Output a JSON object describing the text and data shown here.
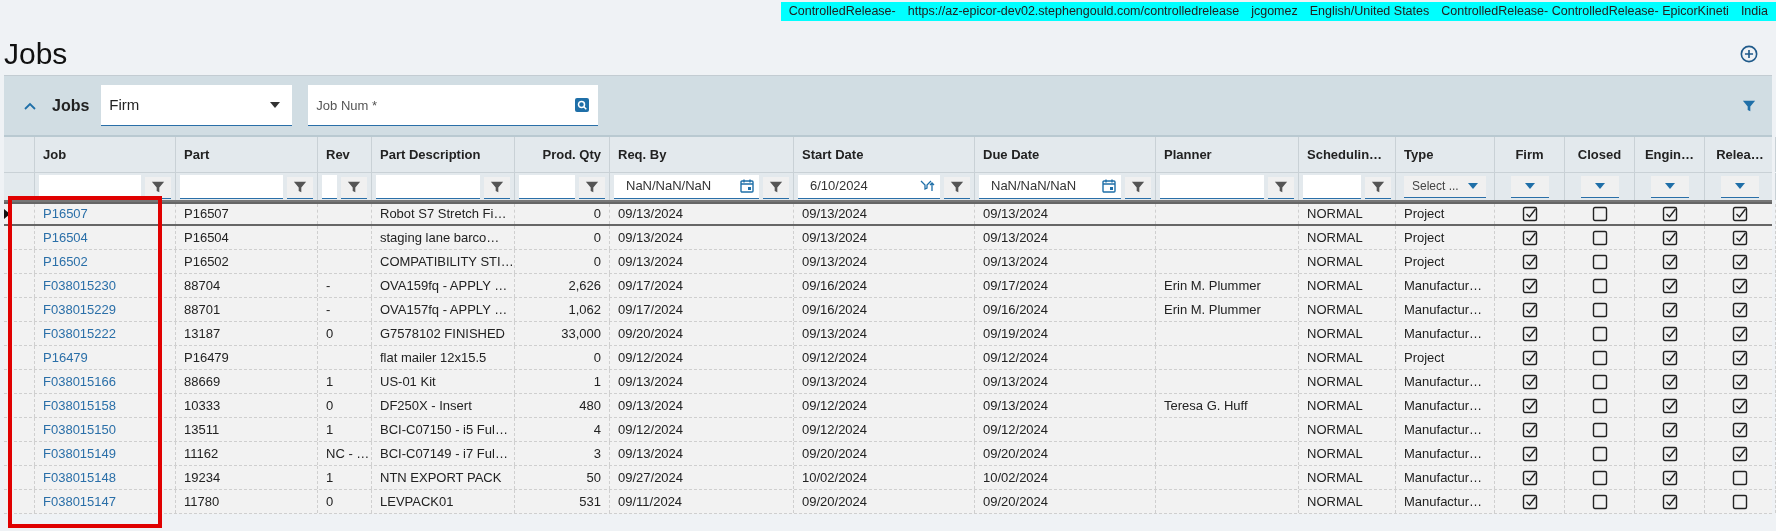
{
  "status_strip": [
    "ControlledRelease-",
    "https://az-epicor-dev02.stephengould.com/controlledrelease",
    "jcgomez",
    "English/United States",
    "ControlledRelease- ControlledRelease- EpicorKineti",
    "India"
  ],
  "page_title": "Jobs",
  "annotation": {
    "kind": "rectangle"
  },
  "panel": {
    "title": "Jobs",
    "expanded": true,
    "view_select": {
      "value": "Firm"
    },
    "search": {
      "placeholder": "Job Num *"
    }
  },
  "columns": [
    {
      "label": "Job",
      "kind": "link",
      "filter": {
        "kind": "text"
      }
    },
    {
      "label": "Part",
      "kind": "text",
      "filter": {
        "kind": "text"
      }
    },
    {
      "label": "Rev",
      "kind": "text",
      "filter": {
        "kind": "text"
      }
    },
    {
      "label": "Part Description",
      "kind": "text",
      "filter": {
        "kind": "text"
      }
    },
    {
      "label": "Prod. Qty",
      "kind": "number",
      "filter": {
        "kind": "text"
      }
    },
    {
      "label": "Req. By",
      "kind": "text",
      "filter": {
        "kind": "date",
        "value": "NaN/NaN/NaN"
      }
    },
    {
      "label": "Start Date",
      "kind": "text",
      "filter": {
        "kind": "daterange",
        "value": "6/10/2024"
      }
    },
    {
      "label": "Due Date",
      "kind": "text",
      "filter": {
        "kind": "date",
        "value": "NaN/NaN/NaN"
      }
    },
    {
      "label": "Planner",
      "kind": "text",
      "filter": {
        "kind": "text"
      }
    },
    {
      "label": "Schedulin…",
      "kind": "text",
      "filter": {
        "kind": "text"
      }
    },
    {
      "label": "Type",
      "kind": "text",
      "filter": {
        "kind": "select",
        "placeholder": "Select ..."
      }
    },
    {
      "label": "Firm",
      "kind": "check",
      "filter": {
        "kind": "dropdown"
      }
    },
    {
      "label": "Closed",
      "kind": "check",
      "filter": {
        "kind": "dropdown"
      }
    },
    {
      "label": "Engin…",
      "kind": "check",
      "filter": {
        "kind": "dropdown"
      }
    },
    {
      "label": "Relea…",
      "kind": "check",
      "filter": {
        "kind": "dropdown"
      }
    }
  ],
  "rows": [
    {
      "selected": true,
      "cells": [
        "P16507",
        "P16507",
        null,
        "Robot S7 Stretch Fi…",
        "0",
        "09/13/2024",
        "09/13/2024",
        "09/13/2024",
        null,
        "NORMAL",
        "Project"
      ],
      "checks": [
        true,
        false,
        true,
        true
      ]
    },
    {
      "selected": false,
      "cells": [
        "P16504",
        "P16504",
        null,
        "staging lane barco…",
        "0",
        "09/13/2024",
        "09/13/2024",
        "09/13/2024",
        null,
        "NORMAL",
        "Project"
      ],
      "checks": [
        true,
        false,
        true,
        true
      ]
    },
    {
      "selected": false,
      "cells": [
        "P16502",
        "P16502",
        null,
        "COMPATIBILITY STI…",
        "0",
        "09/13/2024",
        "09/13/2024",
        "09/13/2024",
        null,
        "NORMAL",
        "Project"
      ],
      "checks": [
        true,
        false,
        true,
        true
      ]
    },
    {
      "selected": false,
      "cells": [
        "F038015230",
        "88704",
        "-",
        "OVA159fq - APPLY …",
        "2,626",
        "09/17/2024",
        "09/16/2024",
        "09/17/2024",
        "Erin M. Plummer",
        "NORMAL",
        "Manufactur…"
      ],
      "checks": [
        true,
        false,
        true,
        true
      ]
    },
    {
      "selected": false,
      "cells": [
        "F038015229",
        "88701",
        "-",
        "OVA157fq - APPLY …",
        "1,062",
        "09/17/2024",
        "09/16/2024",
        "09/16/2024",
        "Erin M. Plummer",
        "NORMAL",
        "Manufactur…"
      ],
      "checks": [
        true,
        false,
        true,
        true
      ]
    },
    {
      "selected": false,
      "cells": [
        "F038015222",
        "13187",
        "0",
        "G7578102 FINISHED",
        "33,000",
        "09/20/2024",
        "09/13/2024",
        "09/19/2024",
        null,
        "NORMAL",
        "Manufactur…"
      ],
      "checks": [
        true,
        false,
        true,
        true
      ]
    },
    {
      "selected": false,
      "cells": [
        "P16479",
        "P16479",
        null,
        "flat mailer 12x15.5",
        "0",
        "09/12/2024",
        "09/12/2024",
        "09/12/2024",
        null,
        "NORMAL",
        "Project"
      ],
      "checks": [
        true,
        false,
        true,
        true
      ]
    },
    {
      "selected": false,
      "cells": [
        "F038015166",
        "88669",
        "1",
        "US-01 Kit",
        "1",
        "09/13/2024",
        "09/13/2024",
        "09/13/2024",
        null,
        "NORMAL",
        "Manufactur…"
      ],
      "checks": [
        true,
        false,
        true,
        true
      ]
    },
    {
      "selected": false,
      "cells": [
        "F038015158",
        "10333",
        "0",
        "DF250X - Insert",
        "480",
        "09/13/2024",
        "09/12/2024",
        "09/13/2024",
        "Teresa G. Huff",
        "NORMAL",
        "Manufactur…"
      ],
      "checks": [
        true,
        false,
        true,
        true
      ]
    },
    {
      "selected": false,
      "cells": [
        "F038015150",
        "13511",
        "1",
        "BCI-C07150 - i5 Ful…",
        "4",
        "09/12/2024",
        "09/12/2024",
        "09/12/2024",
        null,
        "NORMAL",
        "Manufactur…"
      ],
      "checks": [
        true,
        false,
        true,
        true
      ]
    },
    {
      "selected": false,
      "cells": [
        "F038015149",
        "11162",
        "NC - …",
        "BCI-C07149 - i7 Ful…",
        "3",
        "09/13/2024",
        "09/20/2024",
        "09/20/2024",
        null,
        "NORMAL",
        "Manufactur…"
      ],
      "checks": [
        true,
        false,
        true,
        true
      ]
    },
    {
      "selected": false,
      "cells": [
        "F038015148",
        "19234",
        "1",
        "NTN EXPORT PACK",
        "50",
        "09/27/2024",
        "10/02/2024",
        "10/02/2024",
        null,
        "NORMAL",
        "Manufactur…"
      ],
      "checks": [
        true,
        false,
        true,
        false
      ]
    },
    {
      "selected": false,
      "cells": [
        "F038015147",
        "11780",
        "0",
        "LEVPACK01",
        "531",
        "09/11/2024",
        "09/20/2024",
        "09/20/2024",
        null,
        "NORMAL",
        "Manufactur…"
      ],
      "checks": [
        true,
        false,
        true,
        false
      ]
    }
  ]
}
